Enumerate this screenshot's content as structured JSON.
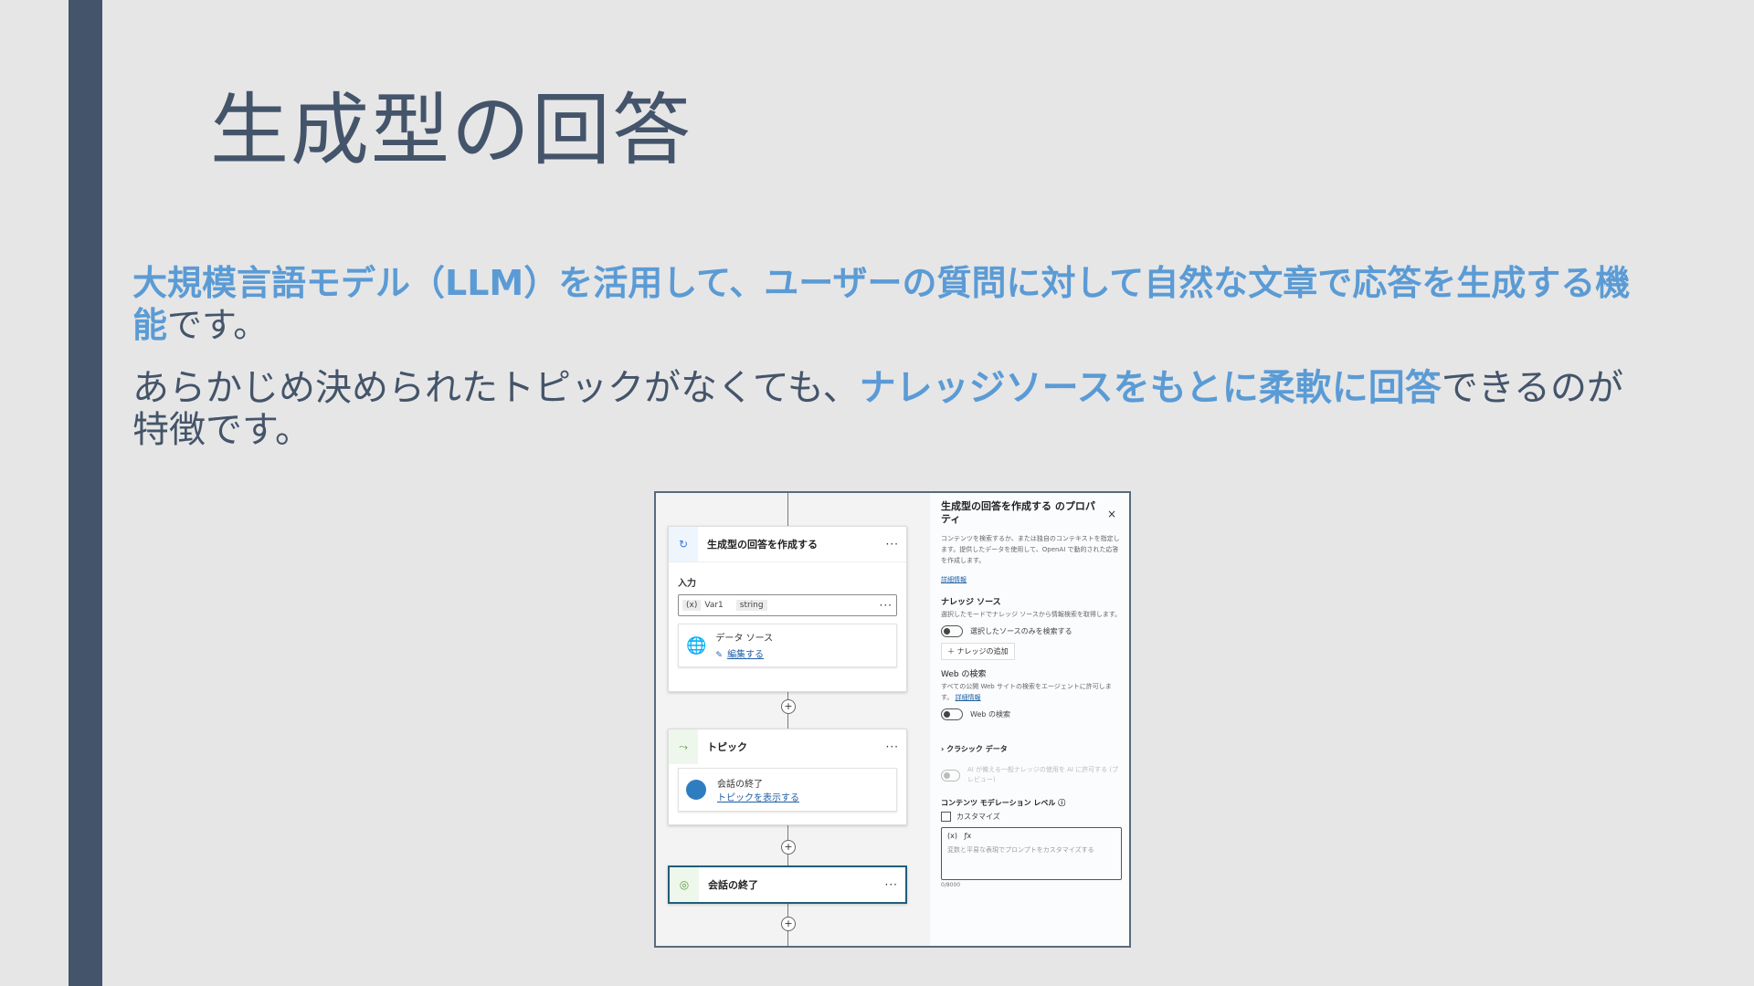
{
  "slide": {
    "title": "生成型の回答",
    "para1": {
      "highlight": "大規模言語モデル（LLM）を活用して、ユーザーの質問に対して自然な文章で応答を生成する機能",
      "rest": "です。"
    },
    "para2": {
      "before": "あらかじめ決められたトピックがなくても、",
      "highlight": "ナレッジソースをもとに柔軟に回答",
      "after": "できるのが特徴です。"
    }
  },
  "canvas": {
    "node1": {
      "title": "生成型の回答を作成する",
      "more": "···",
      "input_label": "入力",
      "var_icon": "(x)",
      "var_name": "Var1",
      "var_type": "string",
      "datasource_label": "データ ソース",
      "edit_link": "編集する"
    },
    "node2": {
      "title": "トピック",
      "more": "···",
      "topic_name": "会話の終了",
      "show_link": "トピックを表示する"
    },
    "node3": {
      "title": "会話の終了",
      "more": "···"
    },
    "plus": "+"
  },
  "panel": {
    "title": "生成型の回答を作成する のプロパティ",
    "close": "×",
    "description": "コンテンツを検索するか、または独自のコンテキストを指定します。提供したデータを使用して、OpenAI で動的された応答を作成します。",
    "learn_more": "詳細情報",
    "knowledge_heading": "ナレッジ ソース",
    "knowledge_desc": "選択したモードでナレッジ ソースから情報検索を取得します。",
    "toggle_selected_only": "選択したソースのみを検索する",
    "add_knowledge": "＋ ナレッジの追加",
    "web_heading": "Web の検索",
    "web_desc": "すべての公開 Web サイトの検索をエージェントに許可します。",
    "web_learn_more": "詳細情報",
    "toggle_web": "Web の検索",
    "classic_heading": "クラシック データ",
    "classic_toggle": "AI が備える一般ナレッジの使用を AI に許可する (プレビュー)",
    "moderation_heading": "コンテンツ モデレーション レベル ⓘ",
    "customize": "カスタマイズ",
    "prompt_placeholder": "変数と平易な表現でプロンプトをカスタマイズする",
    "counter": "0/8000"
  }
}
